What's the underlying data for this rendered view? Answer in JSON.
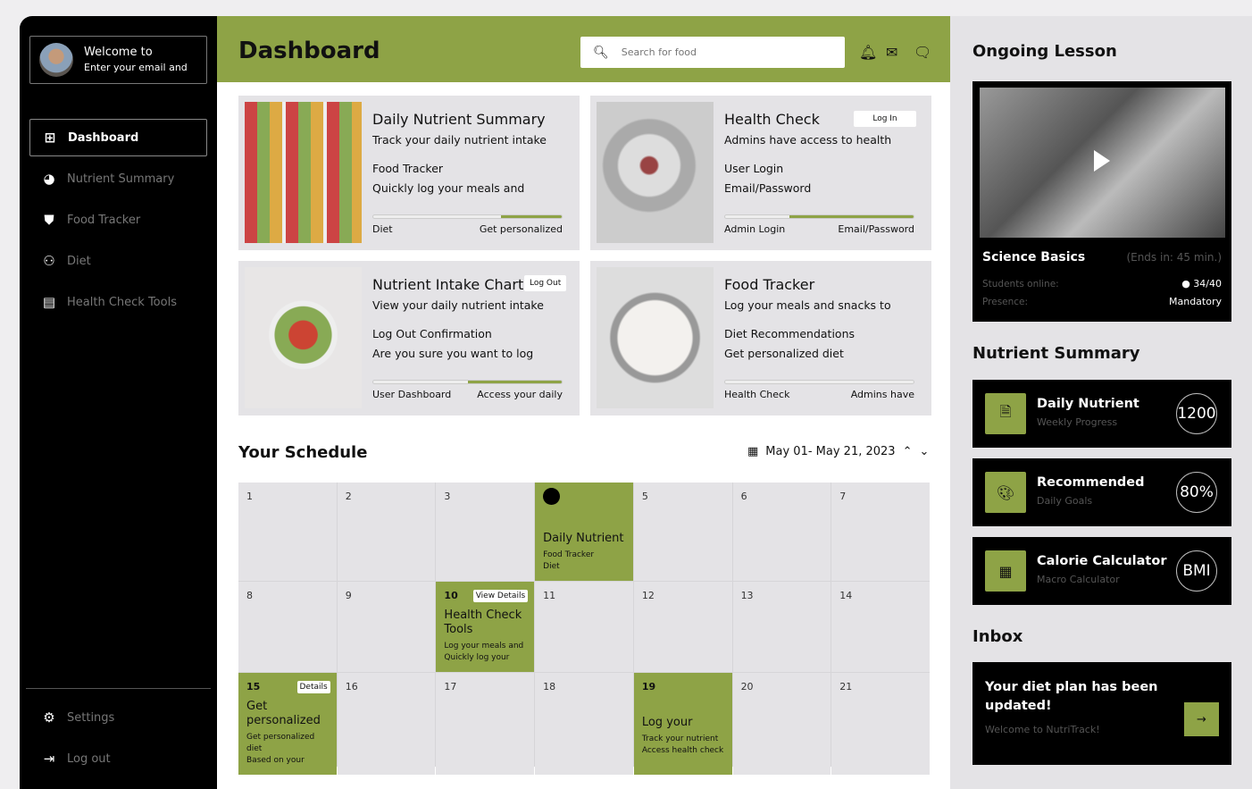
{
  "sidebar": {
    "profile_line1": "Welcome to",
    "profile_line2": "Enter your email and",
    "items": [
      {
        "label": "Dashboard",
        "icon": "grid-icon"
      },
      {
        "label": "Nutrient Summary",
        "icon": "pie-chart-icon"
      },
      {
        "label": "Food Tracker",
        "icon": "shield-lock-icon"
      },
      {
        "label": "Diet",
        "icon": "user-plus-icon"
      },
      {
        "label": "Health Check Tools",
        "icon": "clipboard-icon"
      }
    ],
    "settings": "Settings",
    "logout": "Log out"
  },
  "header": {
    "title": "Dashboard",
    "search_placeholder": "Search for food"
  },
  "cards": [
    {
      "title": "Daily Nutrient Summary",
      "line1": "Track your daily nutrient intake",
      "line2": "Food Tracker",
      "line3": "Quickly log your meals and",
      "bar_left": "Diet",
      "bar_right": "Get personalized",
      "progress": 32
    },
    {
      "title": "Health Check",
      "button": "Log In",
      "line1": "Admins have access to health",
      "line2": "User Login",
      "line3": "Email/Password",
      "bar_left": "Admin Login",
      "bar_right": "Email/Password",
      "progress": 66
    },
    {
      "title": "Nutrient Intake Chart",
      "button": "Log Out",
      "line1": "View your daily nutrient intake",
      "line2": "Log Out Confirmation",
      "line3": "Are you sure you want to log",
      "bar_left": "User Dashboard",
      "bar_right": "Access your daily",
      "progress": 50
    },
    {
      "title": "Food Tracker",
      "line1": "Log your meals and snacks to",
      "line2": "Diet Recommendations",
      "line3": "Get personalized diet",
      "bar_left": "Health Check",
      "bar_right": "Admins have",
      "progress": 0
    }
  ],
  "schedule": {
    "title": "Your Schedule",
    "range": "May 01- May 21, 2023",
    "days": [
      {
        "n": "1"
      },
      {
        "n": "2"
      },
      {
        "n": "3"
      },
      {
        "n": "",
        "event": true,
        "dot": true,
        "title": "Daily Nutrient",
        "sub1": "Food Tracker",
        "sub2": "Diet"
      },
      {
        "n": "5"
      },
      {
        "n": "6"
      },
      {
        "n": "7"
      },
      {
        "n": "8"
      },
      {
        "n": "9"
      },
      {
        "n": "10",
        "event": true,
        "btn": "View Details",
        "title": "Health Check Tools",
        "sub1": "Log your meals and",
        "sub2": "Quickly log your"
      },
      {
        "n": "11"
      },
      {
        "n": "12"
      },
      {
        "n": "13"
      },
      {
        "n": "14"
      },
      {
        "n": "15",
        "event": true,
        "btn": "View Details",
        "title": "Get personalized",
        "sub1": "Get personalized diet",
        "sub2": "Based on your"
      },
      {
        "n": "16"
      },
      {
        "n": "17"
      },
      {
        "n": "18"
      },
      {
        "n": "19",
        "event": true,
        "title": "Log your",
        "sub1": "Track your nutrient",
        "sub2": "Access health check"
      },
      {
        "n": "20"
      },
      {
        "n": "21"
      }
    ]
  },
  "right": {
    "ongoing_title": "Ongoing Lesson",
    "lesson": {
      "name": "Science Basics",
      "ends": "(Ends in: 45 min.)",
      "students_label": "Students online:",
      "students_value": "34/40",
      "presence_label": "Presence:",
      "presence_value": "Mandatory"
    },
    "nutrient_title": "Nutrient Summary",
    "nutrient_cards": [
      {
        "title": "Daily Nutrient",
        "sub": "Weekly Progress",
        "value": "1200",
        "icon": "document-icon"
      },
      {
        "title": "Recommended",
        "sub": "Daily Goals",
        "value": "80%",
        "icon": "palette-icon"
      },
      {
        "title": "Calorie Calculator",
        "sub": "Macro Calculator",
        "value": "BMI",
        "icon": "calculator-icon"
      }
    ],
    "inbox_title": "Inbox",
    "inbox": {
      "message": "Your diet plan has been updated!",
      "sub": "Welcome to NutriTrack!"
    }
  },
  "colors": {
    "accent": "#8ea346",
    "sidebar": "#000000",
    "card": "#e4e3e6"
  }
}
